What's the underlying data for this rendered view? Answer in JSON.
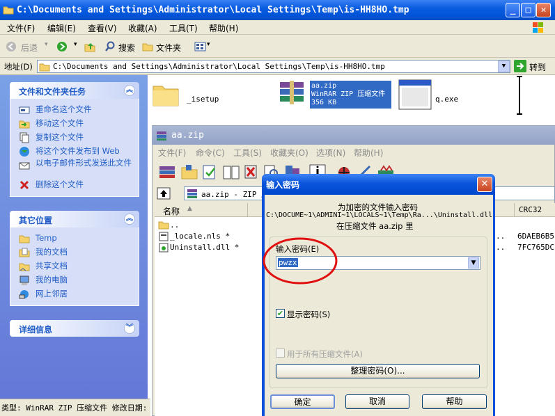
{
  "window": {
    "title": "C:\\Documents and Settings\\Administrator\\Local Settings\\Temp\\is-HH8HO.tmp",
    "minimize": "_",
    "maximize": "□",
    "close": "✕"
  },
  "menu": [
    "文件(F)",
    "编辑(E)",
    "查看(V)",
    "收藏(A)",
    "工具(T)",
    "帮助(H)"
  ],
  "toolbar": {
    "back": "后退",
    "search": "搜索",
    "folders": "文件夹"
  },
  "address": {
    "label": "地址(D)",
    "value": "C:\\Documents and Settings\\Administrator\\Local Settings\\Temp\\is-HH8HO.tmp",
    "go": "转到"
  },
  "tasks": {
    "title": "文件和文件夹任务",
    "items": [
      "重命名这个文件",
      "移动这个文件",
      "复制这个文件",
      "将这个文件发布到 Web",
      "以电子邮件形式发送此文件",
      "删除这个文件"
    ]
  },
  "places": {
    "title": "其它位置",
    "items": [
      "Temp",
      "我的文档",
      "共享文档",
      "我的电脑",
      "网上邻居"
    ]
  },
  "details": {
    "title": "详细信息"
  },
  "status": "类型: WinRAR ZIP 压缩文件 修改日期:",
  "files": [
    {
      "name": "_isetup"
    },
    {
      "name": "aa.zip",
      "type": "WinRAR ZIP 压缩文件",
      "size": "356 KB"
    },
    {
      "name": "q.exe"
    }
  ],
  "rar": {
    "title": "aa.zip",
    "menu": [
      "文件(F)",
      "命令(C)",
      "工具(S)",
      "收藏夹(O)",
      "选项(N)",
      "帮助(H)"
    ],
    "path": "aa.zip - ZIP 压",
    "col_name": "名称",
    "col_crc": "CRC32",
    "rows": [
      {
        "name": "..",
        "crc": ""
      },
      {
        "name": "_locale.nls *",
        "crc": "6DAEB6B5"
      },
      {
        "name": "Uninstall.dll *",
        "crc": "7FC765DC"
      }
    ],
    "trunc": ".."
  },
  "dialog": {
    "title": "输入密码",
    "desc1": "为加密的文件输入密码",
    "desc2": "C:\\DOCUME~1\\ADMINI~1\\LOCALS~1\\Temp\\Ra...\\Uninstall.dll",
    "desc3": "在压缩文件 aa.zip 里",
    "pw_label": "输入密码(E)",
    "pw_value": "pwzx",
    "show_pw": "显示密码(S)",
    "all_archives": "用于所有压缩文件(A)",
    "organize": "整理密码(O)...",
    "ok": "确定",
    "cancel": "取消",
    "help": "帮助"
  },
  "colors": {
    "xp_blue": "#0a5de0",
    "highlight_red": "#e01010",
    "link": "#215dc6"
  }
}
